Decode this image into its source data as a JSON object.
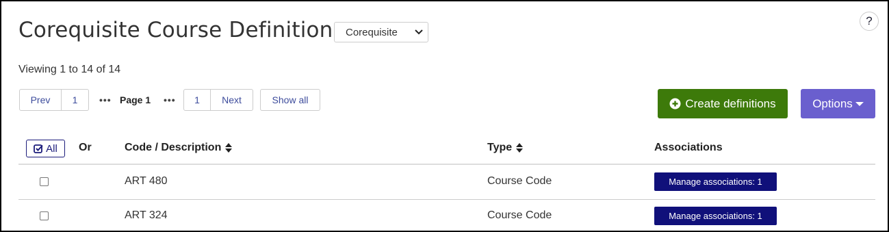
{
  "page": {
    "title": "Corequisite Course Definitions",
    "type_select": {
      "value": "Corequisite"
    },
    "help_label": "?",
    "viewing": "Viewing 1 to 14 of 14"
  },
  "pagination": {
    "prev": "Prev",
    "first_page": "1",
    "dots": "•••",
    "current": "Page 1",
    "last_page": "1",
    "next": "Next",
    "show_all": "Show all"
  },
  "actions": {
    "create": "Create definitions",
    "options": "Options"
  },
  "table": {
    "select_all": "All",
    "headers": {
      "or": "Or",
      "code": "Code / Description",
      "type": "Type",
      "associations": "Associations"
    },
    "rows": [
      {
        "code": "ART 480",
        "type": "Course Code",
        "associations": "Manage associations: 1"
      },
      {
        "code": "ART 324",
        "type": "Course Code",
        "associations": "Manage associations: 1"
      }
    ]
  },
  "colors": {
    "create_green": "#3d7a0a",
    "options_purple": "#6a5fce",
    "assoc_navy": "#10107a",
    "link_blue": "#3d4c9c"
  }
}
